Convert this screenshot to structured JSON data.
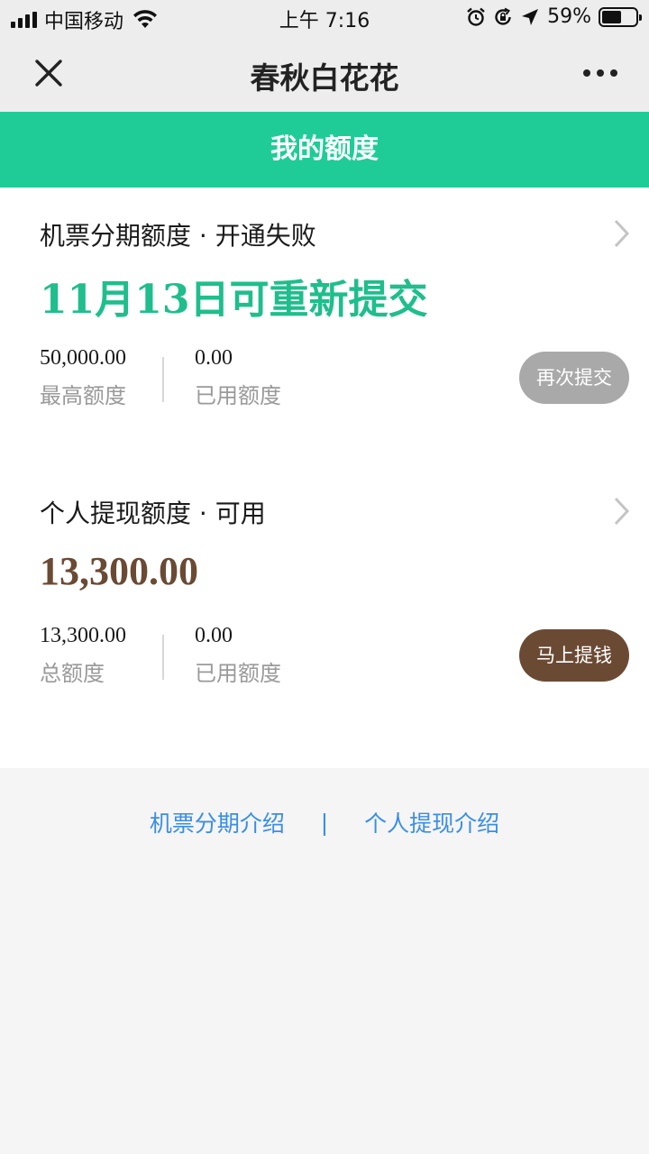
{
  "status_bar": {
    "carrier": "中国移动",
    "time": "上午 7:16",
    "battery_percent": "59%",
    "battery_level": 0.59,
    "icons": [
      "signal-icon",
      "wifi-icon",
      "alarm-icon",
      "rotation-lock-icon",
      "location-icon",
      "battery-icon"
    ]
  },
  "title_bar": {
    "title": "春秋白花花",
    "close_icon": "close-icon",
    "more_icon": "more-icon"
  },
  "header": {
    "title": "我的额度",
    "color": "#1fcc97"
  },
  "cards": [
    {
      "title": "机票分期额度 · 开通失败",
      "headline": "11月13日可重新提交",
      "headline_color": "#1fbe8c",
      "stats": [
        {
          "value": "50,000.00",
          "label": "最高额度"
        },
        {
          "value": "0.00",
          "label": "已用额度"
        }
      ],
      "button": "再次提交",
      "button_color": "#a9a9a9"
    },
    {
      "title": "个人提现额度 · 可用",
      "headline": "13,300.00",
      "headline_color": "#6b4a34",
      "stats": [
        {
          "value": "13,300.00",
          "label": "总额度"
        },
        {
          "value": "0.00",
          "label": "已用额度"
        }
      ],
      "button": "马上提钱",
      "button_color": "#6b4a34"
    }
  ],
  "footer": {
    "link_1": "机票分期介绍",
    "separator": "|",
    "link_2": "个人提现介绍",
    "link_color": "#3a8ee6"
  }
}
